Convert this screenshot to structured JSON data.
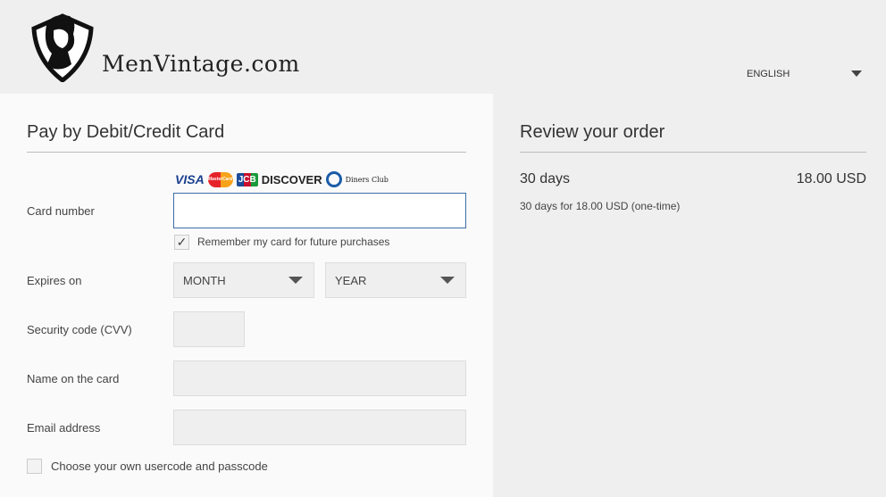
{
  "header": {
    "logo_text": "MenVintage.com",
    "language": "ENGLISH"
  },
  "payment": {
    "title": "Pay by Debit/Credit Card",
    "card_brands": [
      "VISA",
      "MasterCard",
      "JCB",
      "DISCOVER",
      "Diners Club"
    ],
    "card_number_label": "Card number",
    "card_number_value": "",
    "remember_label": "Remember my card for future purchases",
    "remember_checked": true,
    "expires_label": "Expires on",
    "month_value": "MONTH",
    "year_value": "YEAR",
    "cvv_label": "Security code (CVV)",
    "name_label": "Name on the card",
    "email_label": "Email address",
    "usercode_label": "Choose your own usercode and passcode",
    "usercode_checked": false
  },
  "order": {
    "title": "Review your order",
    "item": "30 days",
    "price": "18.00 USD",
    "description": "30 days for 18.00 USD (one-time)"
  }
}
